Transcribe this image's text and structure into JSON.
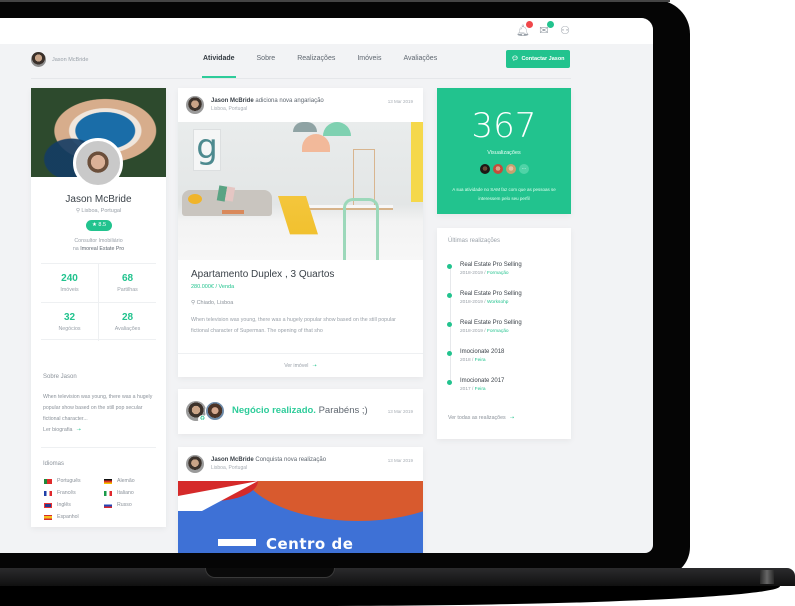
{
  "topbar": {
    "notifications_badge_color": "#f0474a",
    "messages_badge_color": "#22c38e"
  },
  "nav": {
    "user_name": "Jason McBride",
    "tabs": [
      {
        "label": "Atividade",
        "active": true
      },
      {
        "label": "Sobre",
        "active": false
      },
      {
        "label": "Realizações",
        "active": false
      },
      {
        "label": "Imóveis",
        "active": false
      },
      {
        "label": "Avaliações",
        "active": false
      }
    ],
    "contact_button": "Contactar Jason"
  },
  "profile": {
    "name": "Jason McBride",
    "location": "Lisboa, Portugal",
    "rating": "8.5",
    "role_line1": "Consultor Imobiliário",
    "role_prefix": "na",
    "company": "Imoreal Estate Pro",
    "stats": [
      {
        "value": "240",
        "label": "Imóveis"
      },
      {
        "value": "68",
        "label": "Partilhas"
      },
      {
        "value": "32",
        "label": "Negócios"
      },
      {
        "value": "28",
        "label": "Avaliações"
      }
    ],
    "about_title": "Sobre Jason",
    "about_text": "When television was young, there was a hugely popular show based on the still pop secular fictional character...",
    "bio_link": "Ler biografia",
    "languages_title": "Idiomas",
    "languages": [
      {
        "name": "Português",
        "flag": "pt"
      },
      {
        "name": "Alemão",
        "flag": "de"
      },
      {
        "name": "Francês",
        "flag": "fr"
      },
      {
        "name": "Italiano",
        "flag": "it"
      },
      {
        "name": "Inglês",
        "flag": "gb"
      },
      {
        "name": "Russo",
        "flag": "ru"
      },
      {
        "name": "Espanhol",
        "flag": "es"
      }
    ]
  },
  "feed": {
    "post1": {
      "author": "Jason McBride",
      "action": "adiciona nova angariação",
      "location": "Lisboa, Portugal",
      "date": "13 Mar 2019",
      "title": "Apartamento Duplex , 3 Quartos",
      "price": "280.000€  /  Venda",
      "address": "Chiado, Lisboa",
      "description": "When television was young, there was a hugely popular show based on the still popular fictional character of Superman. The opening of that sho",
      "footer_link": "Ver imóvel"
    },
    "post2": {
      "highlight": "Negócio realizado.",
      "text": "Parabéns ;)",
      "date": "13 Mar 2019"
    },
    "post3": {
      "author": "Jason McBride",
      "action": "Conquista nova realização",
      "location": "Lisboa, Portugal",
      "date": "13 Mar 2019",
      "image_text": "Centro de"
    }
  },
  "views": {
    "count": "367",
    "label": "Visualizações",
    "more": "···",
    "description": "A sua atividade no SAM faz com que as pessoas se interessem pelo seu perfil"
  },
  "achievements": {
    "title": "Últimas realizações",
    "items": [
      {
        "name": "Real Estate Pro Selling",
        "year": "2018-2019",
        "tag": "Formação"
      },
      {
        "name": "Real Estate Pro Selling",
        "year": "2018-2019",
        "tag": "Worksohp"
      },
      {
        "name": "Real Estate Pro Selling",
        "year": "2018-2019",
        "tag": "Formação"
      },
      {
        "name": "Imocionate 2018",
        "year": "2018",
        "tag": "Feira"
      },
      {
        "name": "Imocionate 2017",
        "year": "2017",
        "tag": "Feira"
      }
    ],
    "see_all": "Ver todas as realizações"
  },
  "colors": {
    "accent": "#22c38e",
    "text_dark": "#3b4249",
    "text_muted": "#9aa1a9"
  }
}
